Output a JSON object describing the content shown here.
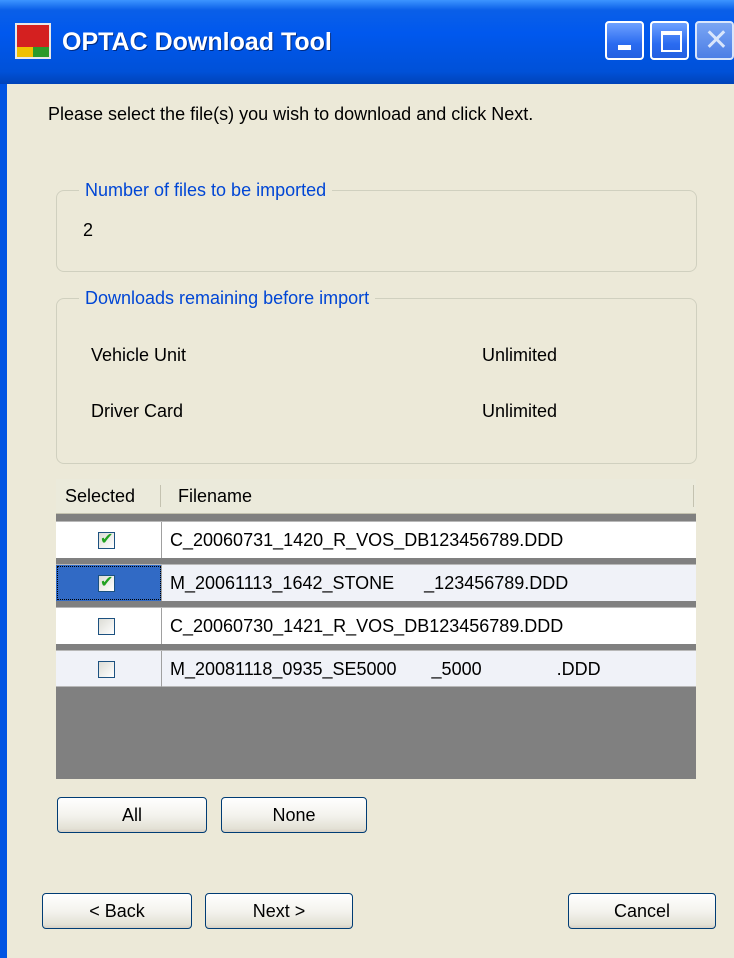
{
  "window": {
    "title": "OPTAC Download Tool"
  },
  "instruction": "Please select the file(s) you wish to download and click Next.",
  "files_group": {
    "label": "Number of files to be imported",
    "count": "2"
  },
  "remaining_group": {
    "label": "Downloads remaining before import",
    "rows": [
      {
        "label": "Vehicle Unit",
        "value": "Unlimited"
      },
      {
        "label": "Driver Card",
        "value": "Unlimited"
      }
    ]
  },
  "grid": {
    "headers": {
      "selected": "Selected",
      "filename": "Filename"
    },
    "rows": [
      {
        "selected": true,
        "filename": "C_20060731_1420_R_VOS_DB123456789.DDD"
      },
      {
        "selected": true,
        "filename": "M_20061113_1642_STONE      _123456789.DDD"
      },
      {
        "selected": false,
        "filename": "C_20060730_1421_R_VOS_DB123456789.DDD"
      },
      {
        "selected": false,
        "filename": "M_20081118_0935_SE5000       _5000               .DDD"
      }
    ]
  },
  "buttons": {
    "all": "All",
    "none": "None",
    "back": "< Back",
    "next": "Next >",
    "cancel": "Cancel"
  },
  "colors": {
    "group_label": "#0046d5",
    "selection": "#316ac5",
    "check": "#21a121"
  }
}
